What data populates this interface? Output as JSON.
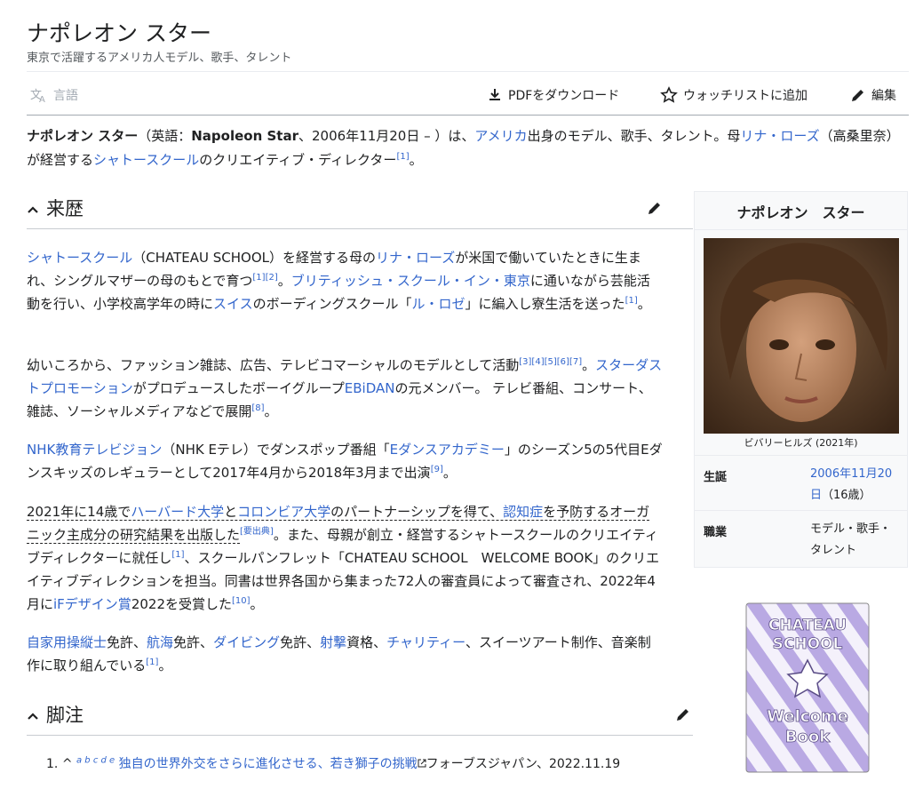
{
  "title": "ナポレオン スター",
  "subtitle": "東京で活躍するアメリカ人モデル、歌手、タレント",
  "toolbar": {
    "language": "言語",
    "pdf": "PDFをダウンロード",
    "watchlist": "ウォッチリストに追加",
    "edit": "編集"
  },
  "intro": {
    "name_bold": "ナポレオン スター",
    "p1": "（英語：",
    "en_name": "Napoleon Star",
    "p2": "、2006年11月20日 – ）は、",
    "link_america": "アメリカ",
    "p3": "出身のモデル、歌手、タレント。母",
    "link_rina": "リナ・ローズ",
    "p4": "（高桑里奈）が経営する",
    "link_chateau": "シャトースクール",
    "p5": "のクリエイティブ・ディレクター",
    "ref1": "[1]",
    "p6": "。"
  },
  "section_history": {
    "heading": "来歴",
    "para1": {
      "link_chateau": "シャトースクール",
      "t1": "（CHATEAU SCHOOL）を経営する母の",
      "link_rina": "リナ・ローズ",
      "t2": "が米国で働いていたときに生まれ、シングルマザーの母のもとで育つ",
      "ref_a": "[1][2]",
      "t3": "。",
      "link_british": "ブリティッシュ・スクール・イン・東京",
      "t4": "に通いながら芸能活動を行い、小学校高学年の時に",
      "link_swiss": "スイス",
      "t5": "のボーディングスクール「",
      "link_rosey": "ル・ロゼ",
      "t6": "」に編入し寮生活を送った",
      "ref_b": "[1]",
      "t7": "。"
    },
    "para2": {
      "t1": "幼いころから、ファッション雑誌、広告、テレビコマーシャルのモデルとして活動",
      "ref_a": "[3][4][5][6][7]",
      "t2": "。",
      "link_stardust": "スターダストプロモーション",
      "t3": "がプロデュースしたボーイグループ",
      "link_ebidan": "EBiDAN",
      "t4": "の元メンバー。 テレビ番組、コンサート、雑誌、ソーシャルメディアなどで展開",
      "ref_b": "[8]",
      "t5": "。"
    },
    "para3": {
      "link_nhk": "NHK教育テレビジョン",
      "t1": "（NHK Eテレ）でダンスポップ番組「",
      "link_edance": "Eダンスアカデミー",
      "t2": "」のシーズン5の5代目Eダンスキッズのレギュラーとして2017年4月から2018年3月まで出演",
      "ref": "[9]",
      "t3": "。"
    },
    "para4": {
      "t1": "2021年に14歳で",
      "link_harvard": "ハーバード大学",
      "t2": "と",
      "link_columbia": "コロンビア大学",
      "t3": "のパートナーシップを得て、",
      "link_dementia": "認知症",
      "t4": "を予防するオーガニック主成分の研究結果を出版した",
      "ref_cite": "[要出典]",
      "t5": "。また、母親が創立・経営するシャトースクールのクリエイティブディレクターに就任し",
      "ref_a": "[1]",
      "t6": "、スクールパンフレット「CHATEAU SCHOOL　WELCOME BOOK」のクリエイティブディレクションを担当。同書は世界各国から集まった72人の審査員によって審査され、2022年4月に",
      "link_ifdesign": "iFデザイン賞",
      "t7": "2022を受賞した",
      "ref_b": "[10]",
      "t8": "。"
    },
    "para5": {
      "link_pilot": "自家用操縦士",
      "t1": "免許、",
      "link_navigation": "航海",
      "t2": "免許、",
      "link_diving": "ダイビング",
      "t3": "免許、",
      "link_shooting": "射撃",
      "t4": "資格、",
      "link_charity": "チャリティー",
      "t5": "、スイーツアート制作、音楽制作に取り組んでいる",
      "ref": "[1]",
      "t6": "。"
    }
  },
  "section_notes": {
    "heading": "脚注",
    "ref1": {
      "num": "1.",
      "caret": "^",
      "letters": "a b c d e",
      "link_title": "独自の世界外交をさらに進化させる、若き獅子の挑戦",
      "source": "フォーブスジャパン、2022.11.19"
    }
  },
  "infobox": {
    "title": "ナポレオン　スター",
    "caption": "ビバリーヒルズ (2021年)",
    "born_label": "生誕",
    "born_date": "2006年11月20日",
    "born_age": "（16歳）",
    "occupation_label": "職業",
    "occupation_value": "モデル・歌手・タレント"
  },
  "book": {
    "line1": "CHATEAU",
    "line2": "SCHOOL",
    "line3": "Welcome",
    "line4": "Book"
  },
  "colors": {
    "link": "#3366cc",
    "text": "#202122",
    "muted": "#54595d",
    "book_stripe": "#b9a9e3"
  }
}
